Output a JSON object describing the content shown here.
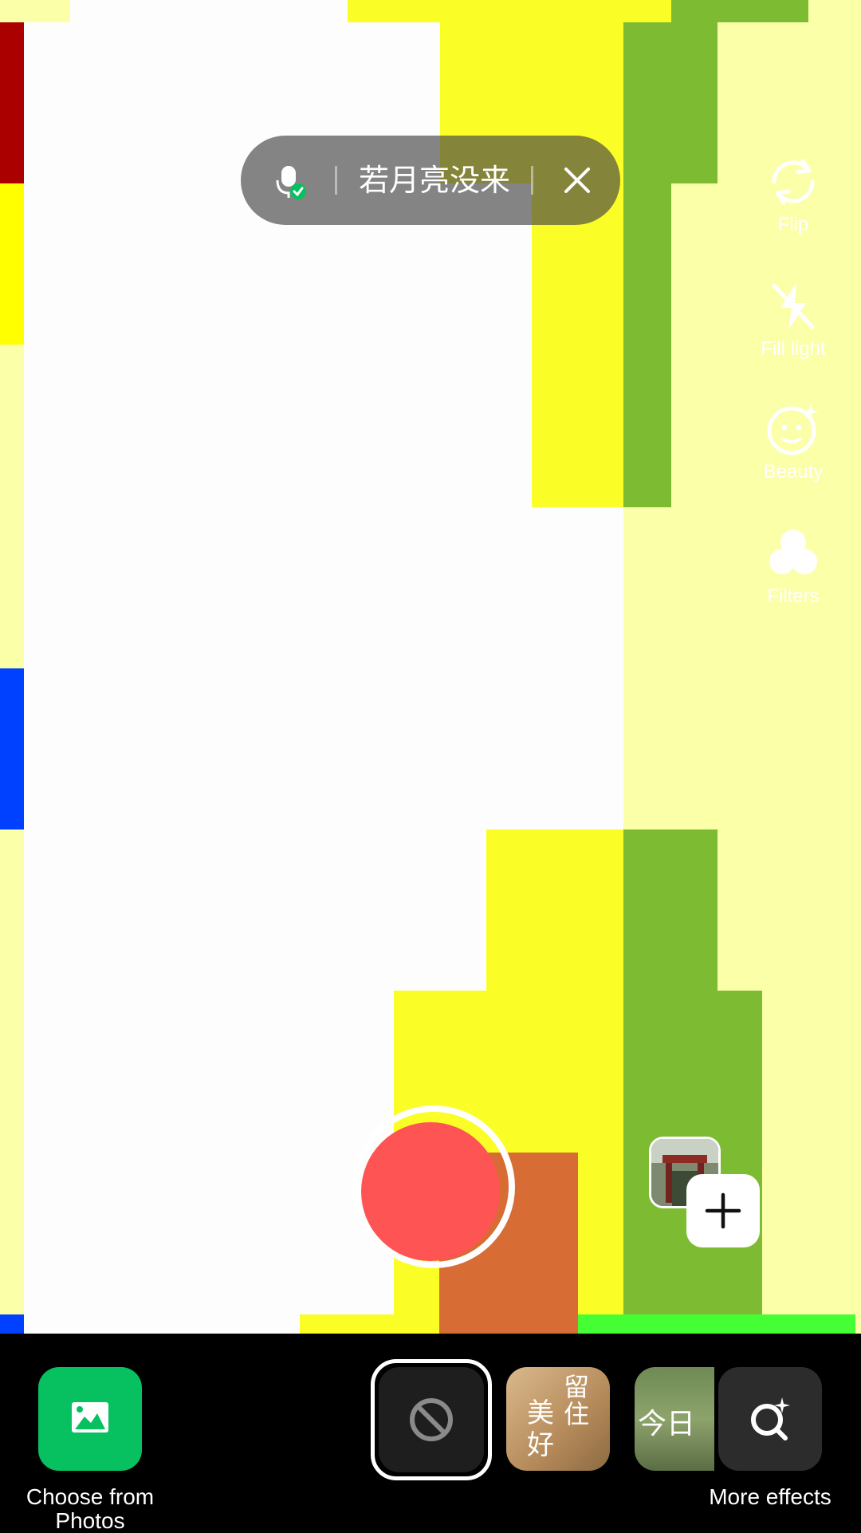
{
  "music": {
    "title": "若月亮没来",
    "icon": "mic-check-icon",
    "close_icon": "close-icon"
  },
  "side_tools": [
    {
      "label": "Flip",
      "icon": "flip-camera-icon"
    },
    {
      "label": "Fill light",
      "icon": "flash-off-icon"
    },
    {
      "label": "Beauty",
      "icon": "beauty-face-icon"
    },
    {
      "label": "Filters",
      "icon": "filters-icon"
    }
  ],
  "bottom": {
    "choose_label": "Choose from Photos",
    "more_label": "More effects",
    "effects": [
      {
        "name": "none",
        "icon": "no-effect-icon"
      },
      {
        "name": "effect-1",
        "overlay_text_a": "留住",
        "overlay_text_b": "美好"
      },
      {
        "name": "effect-2",
        "overlay_text": "今日"
      }
    ]
  },
  "record": {
    "color": "#ff5453"
  },
  "colors": {
    "accent_green": "#07c160"
  }
}
